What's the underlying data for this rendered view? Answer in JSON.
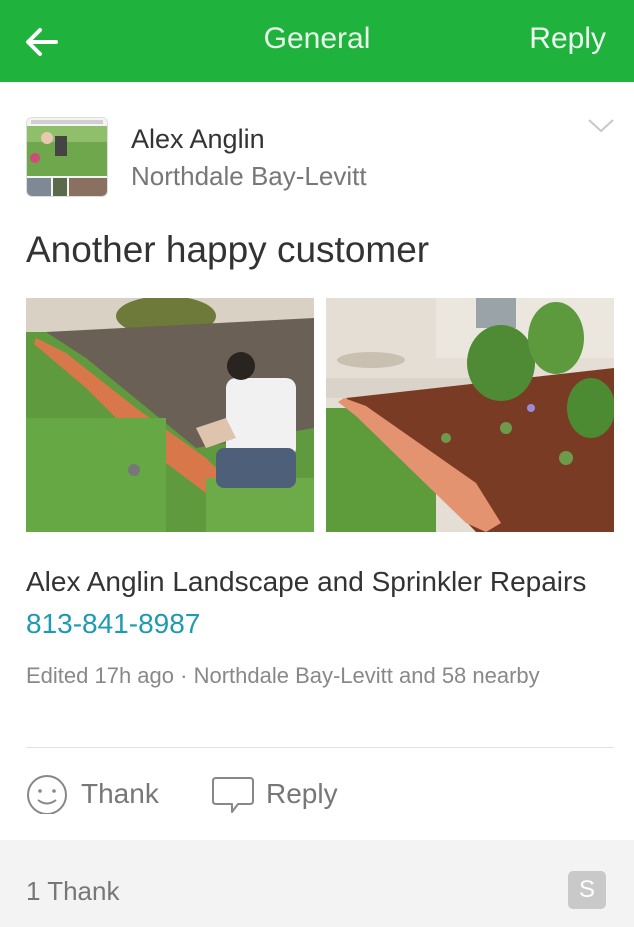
{
  "header": {
    "title": "General",
    "reply_label": "Reply",
    "color": "#1fb33e"
  },
  "post": {
    "author": "Alex Anglin",
    "neighborhood": "Northdale Bay-Levitt",
    "subject": "Another happy customer",
    "body_text": "Alex Anglin Landscape and Sprinkler Repairs ",
    "phone": "813-841-8987",
    "meta": "Edited 17h ago · Northdale Bay-Levitt and 58 nearby",
    "photos": [
      "landscaper-placing-bricks-photo",
      "finished-mulch-bed-photo"
    ]
  },
  "actions": {
    "thank_label": "Thank",
    "reply_label": "Reply"
  },
  "footer": {
    "thank_count": "1 Thank",
    "badge": "S"
  },
  "colors": {
    "link": "#1e9bb0",
    "muted": "#777777"
  }
}
